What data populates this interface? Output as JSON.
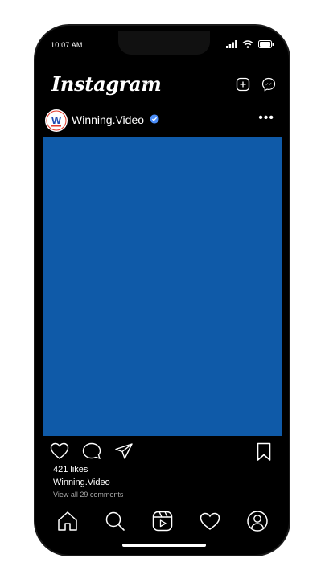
{
  "status": {
    "time": "10:07 AM"
  },
  "app": {
    "brand_name": "Instagram"
  },
  "post": {
    "username": "Winning.Video",
    "avatar_text": "W",
    "likes_text": "421 likes",
    "caption_owner": "Winning.Video",
    "comments_link": "View all 29 comments",
    "media_color": "#0f5aa8"
  },
  "icons": {
    "header": [
      "chevron-down-icon",
      "new-post-icon",
      "messenger-icon"
    ],
    "actions": [
      "heart-icon",
      "comment-icon",
      "share-icon",
      "bookmark-icon"
    ],
    "tabs": [
      "home-icon",
      "search-icon",
      "reels-icon",
      "activity-icon",
      "profile-icon"
    ]
  }
}
